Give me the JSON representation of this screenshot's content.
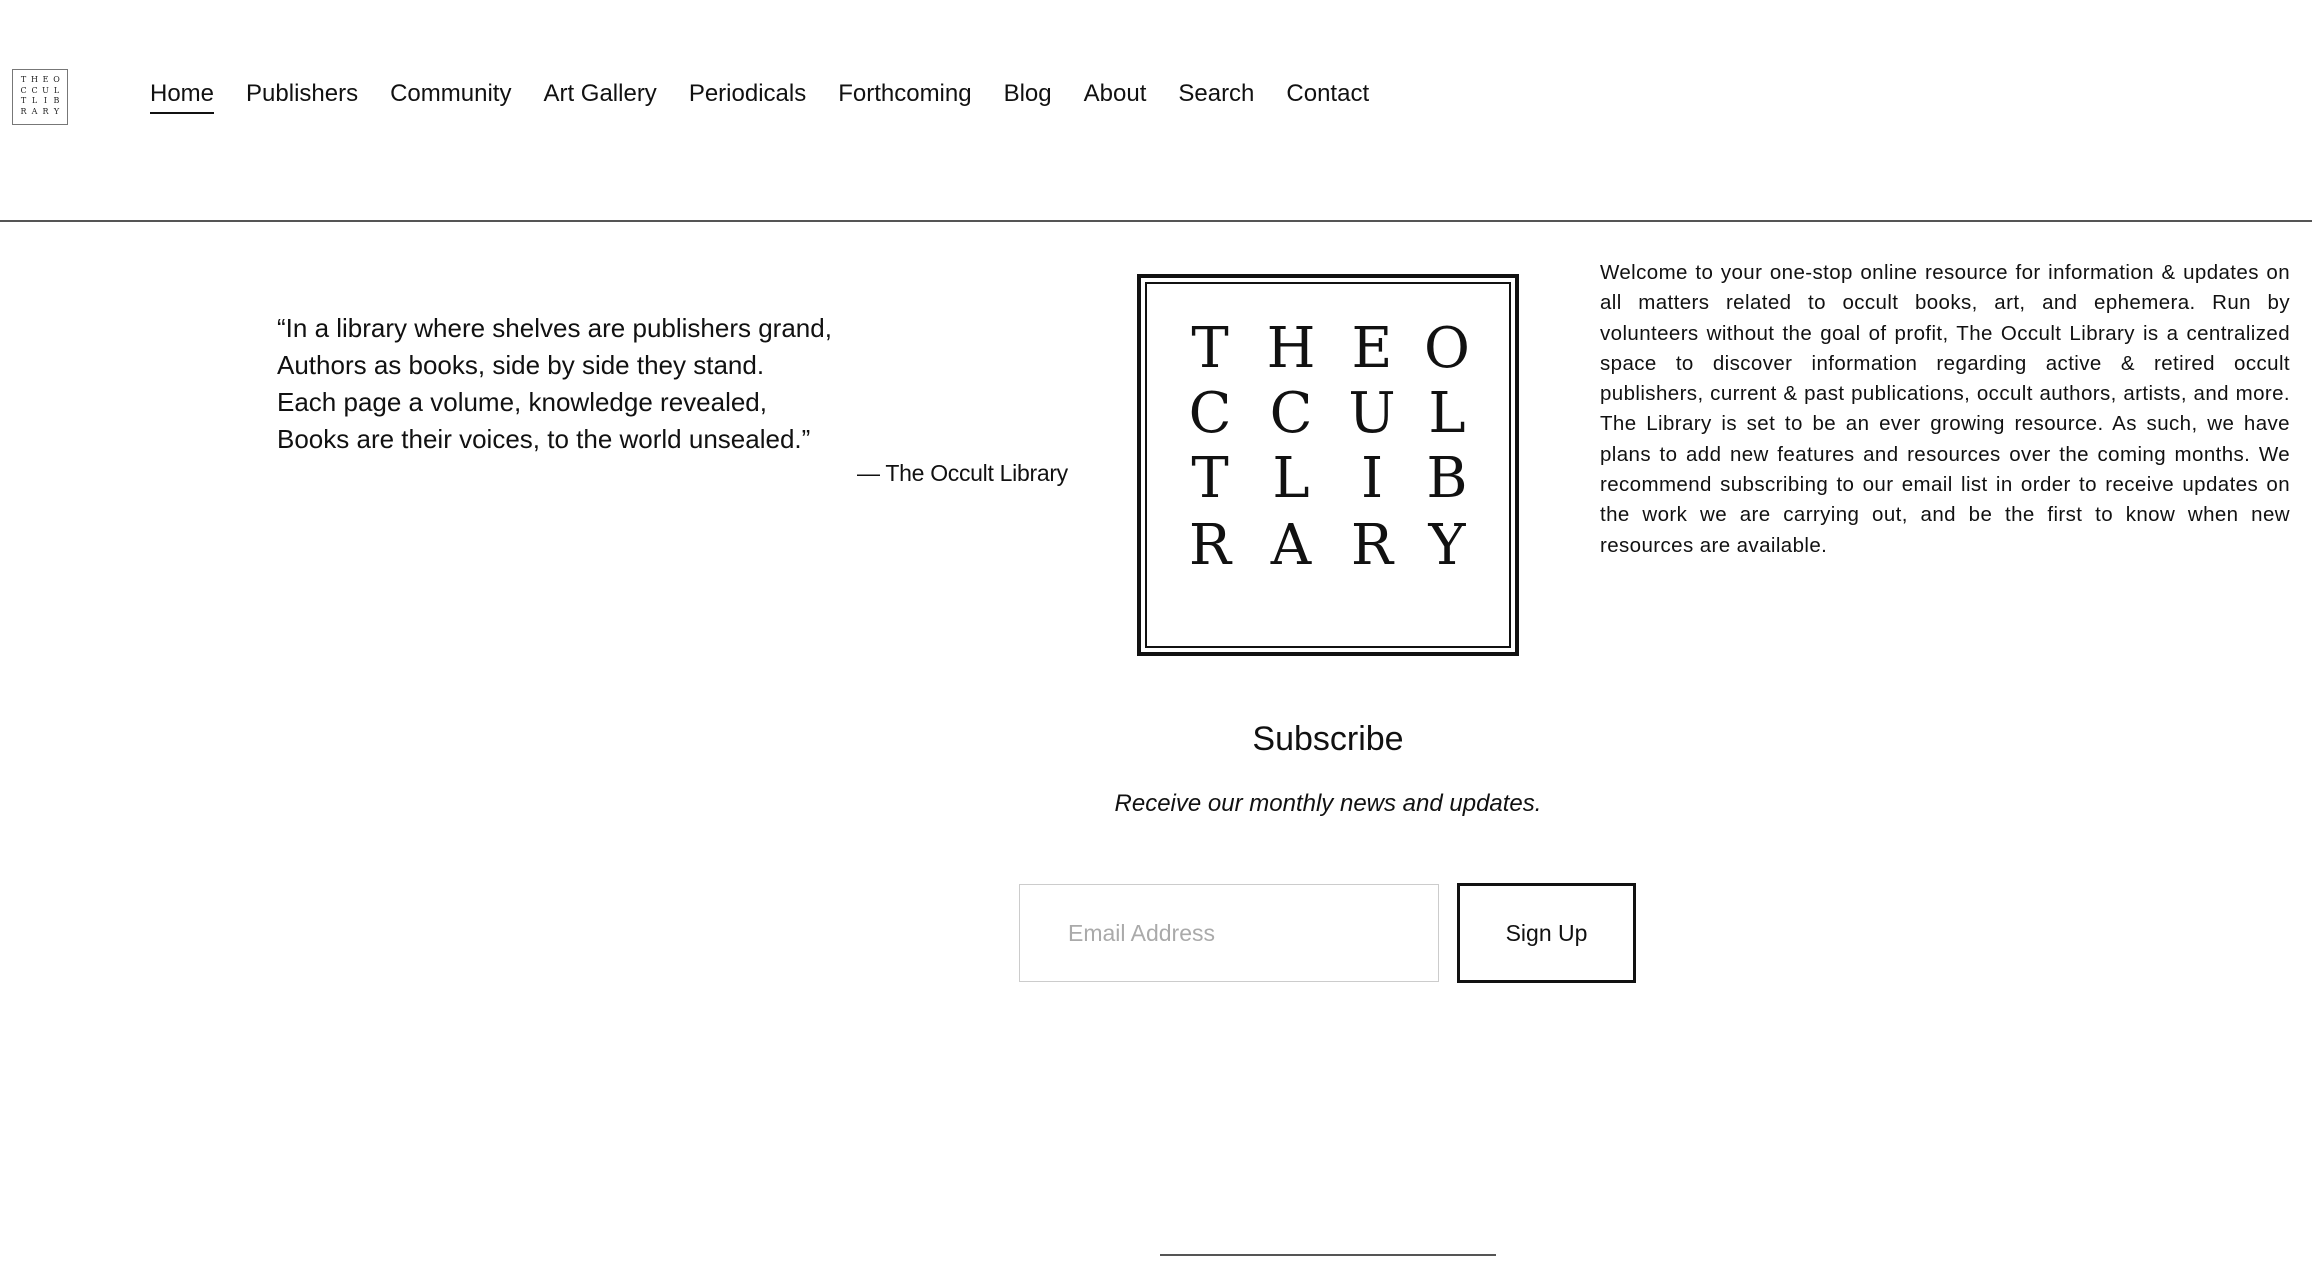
{
  "header": {
    "logo_letters": [
      "T",
      "H",
      "E",
      "O",
      "C",
      "C",
      "U",
      "L",
      "T",
      "L",
      "I",
      "B",
      "R",
      "A",
      "R",
      "Y"
    ],
    "nav": [
      {
        "label": "Home",
        "active": true
      },
      {
        "label": "Publishers",
        "active": false
      },
      {
        "label": "Community",
        "active": false
      },
      {
        "label": "Art Gallery",
        "active": false
      },
      {
        "label": "Periodicals",
        "active": false
      },
      {
        "label": "Forthcoming",
        "active": false
      },
      {
        "label": "Blog",
        "active": false
      },
      {
        "label": "About",
        "active": false
      },
      {
        "label": "Search",
        "active": false
      },
      {
        "label": "Contact",
        "active": false
      }
    ]
  },
  "quote": {
    "lines": [
      "“In a library where shelves are publishers grand,",
      "Authors as books, side by side they stand.",
      "Each page a volume, knowledge revealed,",
      "Books are their voices, to the world unsealed.”"
    ],
    "attribution": "— The Occult Library"
  },
  "emblem": {
    "rows": [
      [
        "T",
        "H",
        "E",
        "O"
      ],
      [
        "C",
        "C",
        "U",
        "L"
      ],
      [
        "T",
        "L",
        "I",
        "B"
      ],
      [
        "R",
        "A",
        "R",
        "Y"
      ]
    ]
  },
  "welcome": {
    "text": "Welcome to your one-stop online resource for information & updates on all matters related to occult books, art, and ephemera. Run by volunteers without the goal of profit, The Occult Library is a centralized space to discover information regarding active & retired occult publishers, current & past publications, occult authors, artists, and more. The Library is set to be an ever growing resource. As such, we have plans to add new features and resources over the coming months. We recommend subscribing to our email list in order to receive updates on the work we are carrying out, and be the first to know when new resources are available."
  },
  "subscribe": {
    "title": "Subscribe",
    "subtitle": "Receive our monthly news and updates.",
    "email_placeholder": "Email Address",
    "button_label": "Sign Up"
  }
}
